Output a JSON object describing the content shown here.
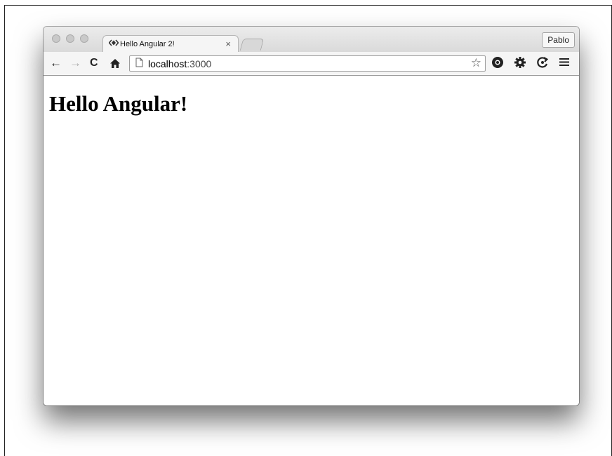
{
  "browser": {
    "tab": {
      "title": "Hello Angular 2!",
      "icon": "angular-logo-icon",
      "close_label": "×"
    },
    "profile_label": "Pablo",
    "toolbar": {
      "back_icon": "←",
      "forward_icon": "→",
      "reload_icon": "C",
      "home_icon": "home-icon"
    },
    "address_bar": {
      "host": "localhost",
      "port": ":3000"
    },
    "extensions": [
      "chrome-extension-icon",
      "settings-gear-icon",
      "sync-icon",
      "menu-icon"
    ]
  },
  "page": {
    "heading": "Hello Angular!"
  }
}
